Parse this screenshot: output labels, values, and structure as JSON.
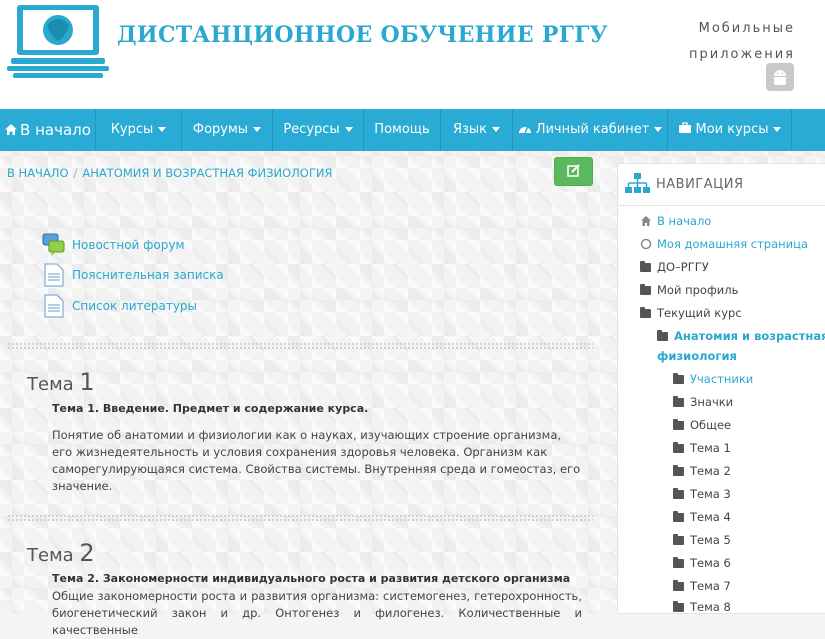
{
  "header": {
    "site_title": "ДИСТАНЦИОННОЕ ОБУЧЕНИЕ РГГУ",
    "mobile_line1": "Мобильные",
    "mobile_line2": "приложения"
  },
  "navbar": {
    "home": "В начало",
    "courses": "Курсы",
    "forums": "Форумы",
    "resources": "Ресурсы",
    "help": "Помощь",
    "language": "Язык",
    "cabinet": "Личный кабинет",
    "my_courses": "Мои курсы"
  },
  "breadcrumb": {
    "home": "В НАЧАЛО",
    "course": "АНАТОМИЯ И ВОЗРАСТНАЯ ФИЗИОЛОГИЯ"
  },
  "activities": [
    {
      "label": "Новостной форум",
      "icon": "forum-icon"
    },
    {
      "label": "Пояснительная записка",
      "icon": "page-icon"
    },
    {
      "label": "Список литературы",
      "icon": "page-icon"
    }
  ],
  "topics": [
    {
      "word": "Тема",
      "num": "1",
      "subtitle": "Тема 1. Введение. Предмет и содержание курса.",
      "text": "Понятие об анатомии и физиологии как о науках, изучающих строение организма, его жизнедеятельность и условия сохранения здоровья человека. Организм как саморегулирующаяся система. Свойства системы. Внутренняя среда и гомеостаз, его значение."
    },
    {
      "word": "Тема",
      "num": "2",
      "subtitle": "Тема 2. Закономерности индивидуального роста и развития детского организма",
      "text": "Общие закономерности роста и развития организма: системогенез, гетерохронность, биогенетический закон и др. Онтогенез и филогенез. Количественные и качественные"
    }
  ],
  "navigation": {
    "title": "НАВИГАЦИЯ",
    "items": [
      {
        "label": "В начало",
        "type": "link",
        "icon": "home-icon"
      },
      {
        "label": "Моя домашняя страница",
        "type": "link",
        "icon": "circle-icon"
      },
      {
        "label": "ДО–РГГУ",
        "type": "plain",
        "icon": "folder-icon"
      },
      {
        "label": "Мой профиль",
        "type": "plain",
        "icon": "folder-icon"
      },
      {
        "label": "Текущий курс",
        "type": "plain",
        "icon": "folder-icon"
      },
      {
        "label_line1": "Анатомия и возрастная",
        "label_line2": "физиология",
        "type": "link-bold",
        "icon": "folder-icon"
      },
      {
        "label": "Участники",
        "type": "link",
        "icon": "folder-icon"
      },
      {
        "label": "Значки",
        "type": "plain",
        "icon": "folder-icon"
      },
      {
        "label": "Общее",
        "type": "plain",
        "icon": "folder-icon"
      },
      {
        "label": "Тема 1",
        "type": "plain",
        "icon": "folder-icon"
      },
      {
        "label": "Тема 2",
        "type": "plain",
        "icon": "folder-icon"
      },
      {
        "label": "Тема 3",
        "type": "plain",
        "icon": "folder-icon"
      },
      {
        "label": "Тема 4",
        "type": "plain",
        "icon": "folder-icon"
      },
      {
        "label": "Тема 5",
        "type": "plain",
        "icon": "folder-icon"
      },
      {
        "label": "Тема 6",
        "type": "plain",
        "icon": "folder-icon"
      },
      {
        "label": "Тема 7",
        "type": "plain",
        "icon": "folder-icon"
      },
      {
        "label": "Тема 8",
        "type": "plain",
        "icon": "folder-icon"
      }
    ]
  },
  "colors": {
    "brand": "#29abd5",
    "edit_button": "#5cb85c"
  }
}
